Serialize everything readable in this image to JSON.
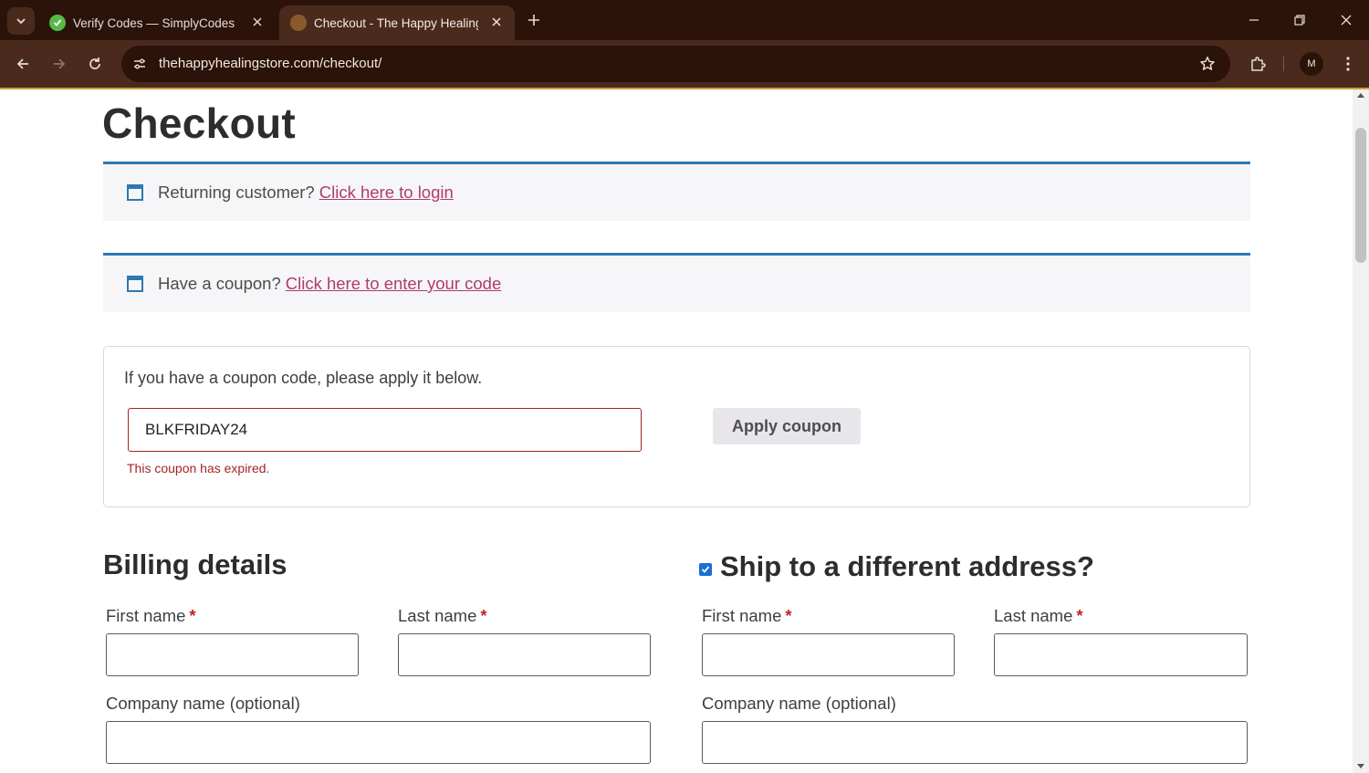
{
  "browser": {
    "tabs": [
      {
        "title": "Verify Codes — SimplyCodes",
        "active": false
      },
      {
        "title": "Checkout - The Happy Healing",
        "active": true
      }
    ],
    "url": "thehappyhealingstore.com/checkout/",
    "profile_initial": "M",
    "colors": {
      "chrome_dark": "#2b1309",
      "chrome_mid": "#4a2a1d"
    }
  },
  "page": {
    "title": "Checkout",
    "notices": {
      "login": {
        "text": "Returning customer?",
        "link": "Click here to login"
      },
      "coupon": {
        "text": "Have a coupon?",
        "link": "Click here to enter your code"
      }
    },
    "coupon_form": {
      "hint": "If you have a coupon code, please apply it below.",
      "code_value": "BLKFRIDAY24",
      "error": "This coupon has expired.",
      "apply_label": "Apply coupon"
    },
    "billing": {
      "title": "Billing details",
      "first_name_label": "First name",
      "last_name_label": "Last name",
      "company_label": "Company name (optional)",
      "required_mark": "*"
    },
    "shipping": {
      "title": "Ship to a different address?",
      "checked": true,
      "first_name_label": "First name",
      "last_name_label": "Last name",
      "company_label": "Company name (optional)",
      "required_mark": "*"
    },
    "colors": {
      "accent_blue": "#2f78b1",
      "link": "#b03b6d",
      "error": "#a52326"
    }
  }
}
